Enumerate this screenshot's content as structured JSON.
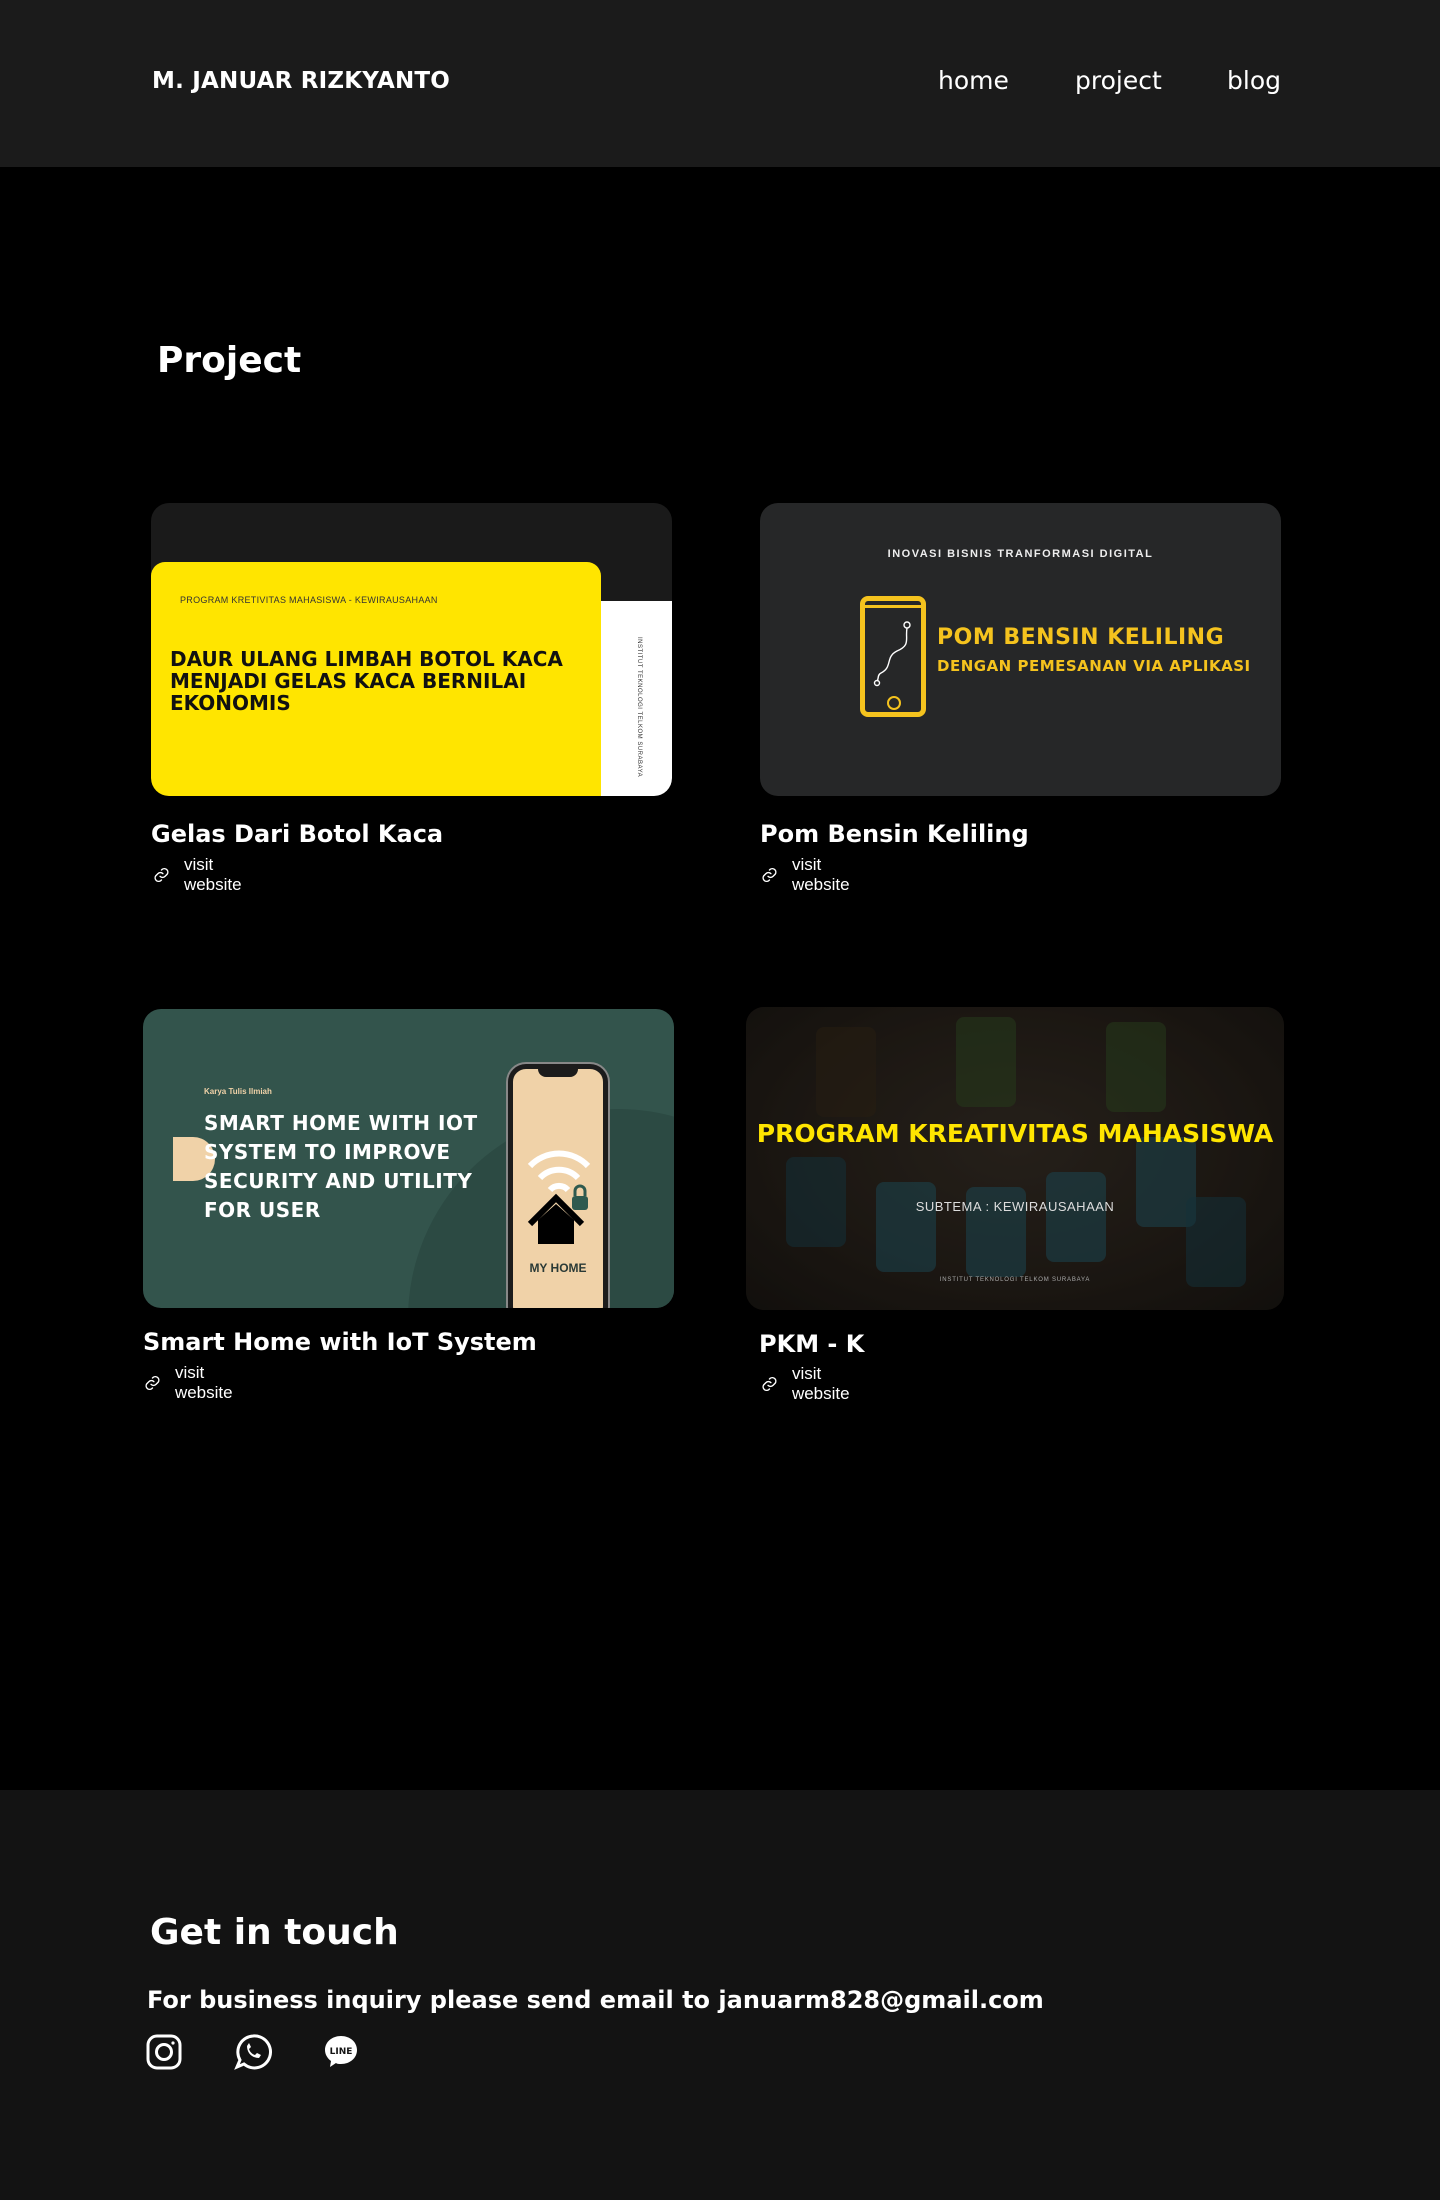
{
  "header": {
    "brand": "M. JANUAR RIZKYANTO",
    "nav": [
      "home",
      "project",
      "blog"
    ]
  },
  "projects_section": {
    "title": "Project",
    "link_label": "visit website",
    "cards": [
      {
        "title": "Gelas Dari Botol Kaca",
        "thumb_kicker": "PROGRAM KRETIVITAS MAHASISWA - KEWIRAUSAHAAN",
        "thumb_headline": "DAUR ULANG LIMBAH BOTOL KACA MENJADI GELAS KACA BERNILAI EKONOMIS",
        "thumb_side": "INSTITUT TEKNOLOGI TELKOM SURABAYA"
      },
      {
        "title": "Pom Bensin Keliling",
        "thumb_top": "INOVASI BISNIS TRANFORMASI DIGITAL",
        "thumb_line1": "POM BENSIN KELILING",
        "thumb_line2": "DENGAN PEMESANAN VIA APLIKASI"
      },
      {
        "title": "Smart Home with IoT System",
        "thumb_kicker": "Karya Tulis Ilmiah",
        "thumb_headline": "SMART HOME WITH IOT SYSTEM TO IMPROVE SECURITY AND UTILITY FOR USER",
        "thumb_phone_label": "MY HOME"
      },
      {
        "title": "PKM - K",
        "thumb_main": "PROGRAM KREATIVITAS MAHASISWA",
        "thumb_sub": "SUBTEMA : KEWIRAUSAHAAN",
        "thumb_foot": "INSTITUT TEKNOLOGI TELKOM SURABAYA"
      }
    ]
  },
  "footer": {
    "title": "Get in touch",
    "text": "For business inquiry please send email to januarm828@gmail.com",
    "socials": [
      {
        "name": "instagram-icon"
      },
      {
        "name": "whatsapp-icon"
      },
      {
        "name": "line-icon",
        "glyph": "LINE"
      }
    ]
  },
  "colors": {
    "header_bg": "#1b1b1b",
    "page_bg": "#000000",
    "footer_bg": "#131313",
    "accent_yellow": "#ffe500",
    "accent_gold": "#f5c31e",
    "card3_green": "#33544c"
  }
}
